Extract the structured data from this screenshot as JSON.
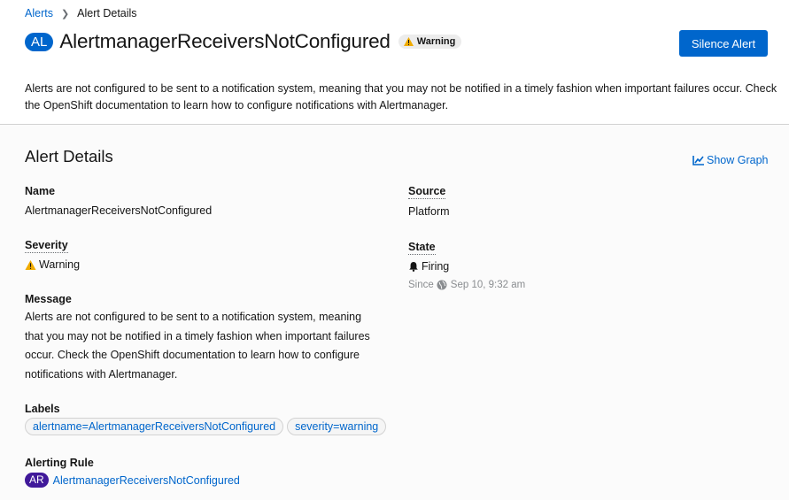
{
  "breadcrumb": {
    "root": "Alerts",
    "current": "Alert Details"
  },
  "header": {
    "badge": "AL",
    "title": "AlertmanagerReceiversNotConfigured",
    "severity_pill": "Warning",
    "silence_button": "Silence Alert",
    "description": "Alerts are not configured to be sent to a notification system, meaning that you may not be notified in a timely fashion when important failures occur. Check the OpenShift documentation to learn how to configure notifications with Alertmanager."
  },
  "details": {
    "heading": "Alert Details",
    "show_graph": "Show Graph",
    "name_label": "Name",
    "name_value": "AlertmanagerReceiversNotConfigured",
    "severity_label": "Severity",
    "severity_value": "Warning",
    "message_label": "Message",
    "message_value": "Alerts are not configured to be sent to a notification system, meaning that you may not be notified in a timely fashion when important failures occur. Check the OpenShift documentation to learn how to configure notifications with Alertmanager.",
    "labels_label": "Labels",
    "labels": [
      "alertname=AlertmanagerReceiversNotConfigured",
      "severity=warning"
    ],
    "rule_label": "Alerting Rule",
    "rule_badge": "AR",
    "rule_link": "AlertmanagerReceiversNotConfigured",
    "source_label": "Source",
    "source_value": "Platform",
    "state_label": "State",
    "state_value": "Firing",
    "since_label": "Since",
    "since_value": "Sep 10, 9:32 am"
  },
  "colors": {
    "accent": "#0066cc",
    "warning": "#f0ab00",
    "rule_badge": "#40199a"
  },
  "icons": [
    "chevron-right-icon",
    "warning-icon",
    "chart-icon",
    "bell-icon",
    "globe-icon"
  ]
}
